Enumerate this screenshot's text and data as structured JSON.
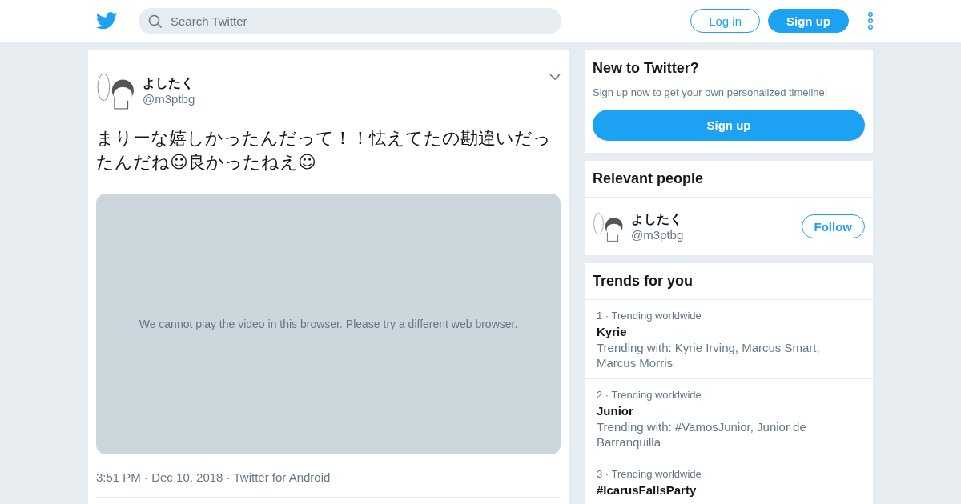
{
  "header": {
    "search": {
      "placeholder": "Search Twitter"
    },
    "buttons": [
      {
        "label": "Log in",
        "kind": "outline"
      },
      {
        "label": "Sign up",
        "kind": "filled"
      }
    ]
  },
  "tweet": {
    "author": {
      "name": "よしたく",
      "handle": "@m3ptbg"
    },
    "text": "まりーな嬉しかったんだって！！怯えてたの勘違いだったんだね☺良かったねえ☺",
    "media": {
      "message": "We cannot play the video in this browser. Please try a different web browser."
    },
    "meta": "3:51 PM · Dec 10, 2018 · Twitter for Android"
  },
  "signup_card": {
    "title": "New to Twitter?",
    "subtitle": "Sign up now to get your own personalized timeline!",
    "button": "Sign up"
  },
  "relevant_people": {
    "title": "Relevant people",
    "people": [
      {
        "name": "よしたく",
        "handle": "@m3ptbg",
        "button": "Follow"
      }
    ]
  },
  "trends": {
    "title": "Trends for you",
    "items": [
      {
        "context": "1 · Trending worldwide",
        "name": "Kyrie",
        "related": "Trending with: Kyrie Irving, Marcus Smart, Marcus Morris"
      },
      {
        "context": "2 · Trending worldwide",
        "name": "Junior",
        "related": "Trending with: #VamosJunior, Junior de Barranquilla"
      },
      {
        "context": "3 · Trending worldwide",
        "name": "#IcarusFallsParty"
      }
    ]
  }
}
